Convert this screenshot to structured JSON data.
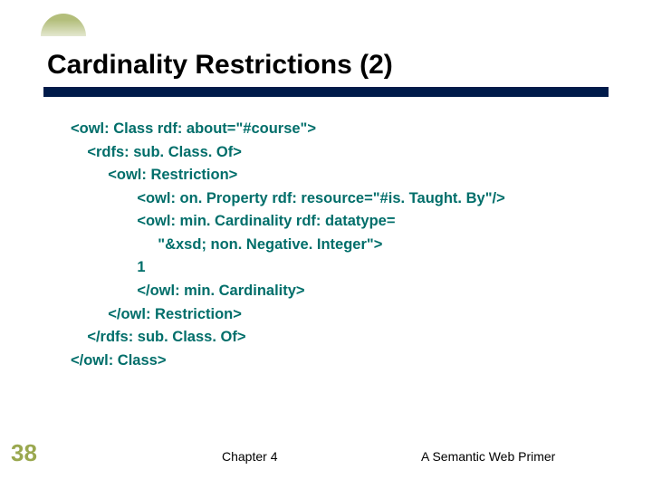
{
  "title": "Cardinality Restrictions (2)",
  "code": {
    "l1": "<owl: Class rdf: about=\"#course\">",
    "l2": "    <rdfs: sub. Class. Of>",
    "l3": "         <owl: Restriction>",
    "l4": "                <owl: on. Property rdf: resource=\"#is. Taught. By\"/>",
    "l5": "                <owl: min. Cardinality rdf: datatype=",
    "l6": "                     \"&xsd; non. Negative. Integer\">",
    "l7": "                1",
    "l8": "                </owl: min. Cardinality>",
    "l9": "         </owl: Restriction>",
    "l10": "    </rdfs: sub. Class. Of>",
    "l11": "</owl: Class>"
  },
  "slide_number": "38",
  "footer_left": "Chapter 4",
  "footer_right": "A Semantic Web Primer"
}
